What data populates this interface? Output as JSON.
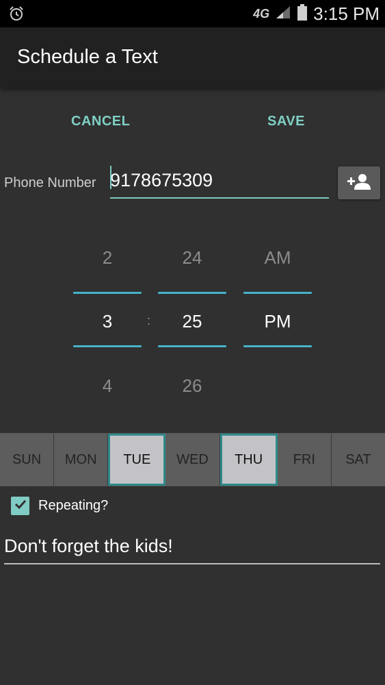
{
  "status_bar": {
    "network": "4G",
    "time": "3:15 PM",
    "icons": [
      "alarm-clock-icon",
      "signal-icon",
      "battery-icon"
    ]
  },
  "app_bar": {
    "title": "Schedule a Text"
  },
  "actions": {
    "cancel_label": "CANCEL",
    "save_label": "SAVE"
  },
  "phone": {
    "label": "Phone Number",
    "value": "9178675309",
    "contact_icon": "add-contact-icon"
  },
  "time_picker": {
    "hour": {
      "prev": "2",
      "selected": "3",
      "next": "4"
    },
    "separator": ":",
    "minute": {
      "prev": "24",
      "selected": "25",
      "next": "26"
    },
    "period": {
      "prev": "AM",
      "selected": "PM"
    }
  },
  "days": [
    {
      "label": "SUN",
      "selected": false
    },
    {
      "label": "MON",
      "selected": false
    },
    {
      "label": "TUE",
      "selected": true
    },
    {
      "label": "WED",
      "selected": false
    },
    {
      "label": "THU",
      "selected": true
    },
    {
      "label": "FRI",
      "selected": false
    },
    {
      "label": "SAT",
      "selected": false
    }
  ],
  "repeating": {
    "label": "Repeating?",
    "checked": true
  },
  "message": {
    "value": "Don't forget the kids!"
  },
  "colors": {
    "accent": "#80cbc4",
    "picker_line": "#46b3c8",
    "background": "#303030",
    "app_bar": "#212121"
  }
}
